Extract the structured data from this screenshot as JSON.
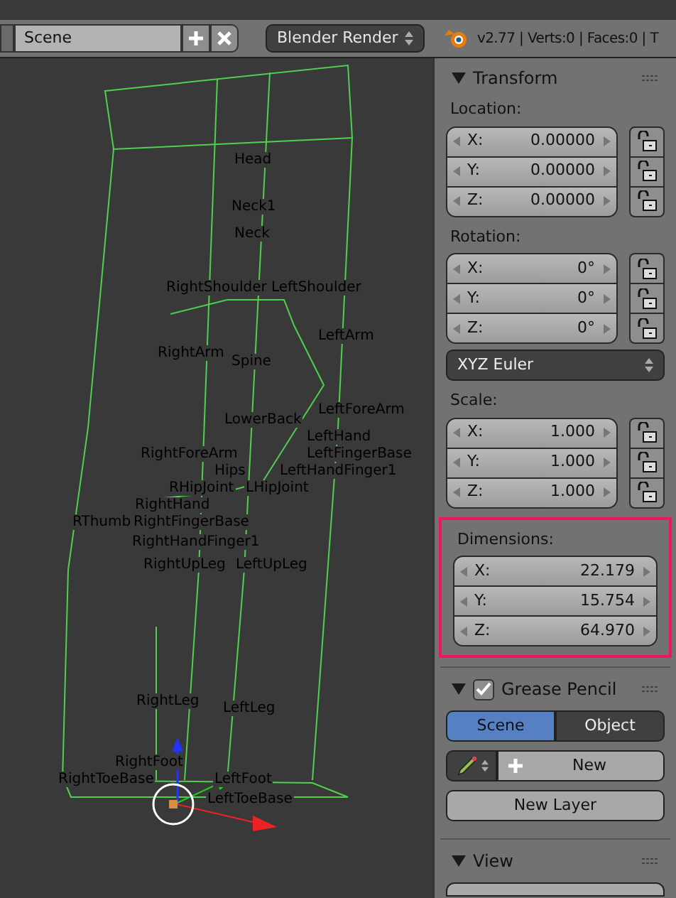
{
  "header": {
    "scene_field": "Scene",
    "render_engine": "Blender Render",
    "stats": "v2.77 | Verts:0 | Faces:0 | T"
  },
  "viewport": {
    "bone_labels": [
      "Head",
      "Neck1",
      "Neck",
      "RightShoulder",
      "LeftShoulder",
      "LeftArm",
      "RightArm",
      "Spine",
      "LeftForeArm",
      "LowerBack",
      "LeftHand",
      "RightForeArm",
      "LeftFingerBase",
      "Hips",
      "LeftHandFinger1",
      "RHipJoint",
      "LHipJoint",
      "RightHand",
      "RThumb",
      "RightFingerBase",
      "RightHandFinger1",
      "RightUpLeg",
      "LeftUpLeg",
      "RightLeg",
      "LeftLeg",
      "RightFoot",
      "RightToeBase",
      "LeftFoot",
      "LeftToeBase"
    ]
  },
  "transform": {
    "title": "Transform",
    "expanded": true,
    "location": {
      "label": "Location:",
      "fields": [
        {
          "axis": "X:",
          "value": "0.00000",
          "locked": false
        },
        {
          "axis": "Y:",
          "value": "0.00000",
          "locked": false
        },
        {
          "axis": "Z:",
          "value": "0.00000",
          "locked": false
        }
      ]
    },
    "rotation": {
      "label": "Rotation:",
      "fields": [
        {
          "axis": "X:",
          "value": "0°",
          "locked": false
        },
        {
          "axis": "Y:",
          "value": "0°",
          "locked": false
        },
        {
          "axis": "Z:",
          "value": "0°",
          "locked": false
        }
      ]
    },
    "rotation_mode": "XYZ Euler",
    "scale": {
      "label": "Scale:",
      "fields": [
        {
          "axis": "X:",
          "value": "1.000",
          "locked": false
        },
        {
          "axis": "Y:",
          "value": "1.000",
          "locked": false
        },
        {
          "axis": "Z:",
          "value": "1.000",
          "locked": false
        }
      ]
    },
    "dimensions": {
      "label": "Dimensions:",
      "highlighted": true,
      "fields": [
        {
          "axis": "X:",
          "value": "22.179"
        },
        {
          "axis": "Y:",
          "value": "15.754"
        },
        {
          "axis": "Z:",
          "value": "64.970"
        }
      ]
    }
  },
  "grease_pencil": {
    "title": "Grease Pencil",
    "expanded": true,
    "enabled": true,
    "source_tabs": [
      {
        "label": "Scene",
        "selected": true
      },
      {
        "label": "Object",
        "selected": false
      }
    ],
    "new_button": "New",
    "new_layer_button": "New Layer"
  },
  "view": {
    "title": "View",
    "expanded": true
  }
}
